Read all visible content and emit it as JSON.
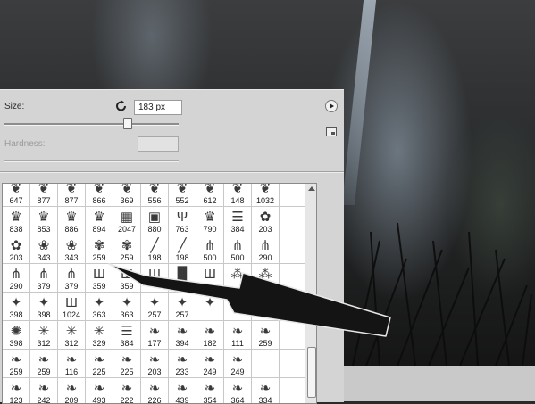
{
  "brush_panel": {
    "size_label": "Size:",
    "size_value": "183 px",
    "size_slider_fraction": 0.72,
    "hardness_label": "Hardness:",
    "hardness_value": "",
    "icons": {
      "reset": "reset-rotate-icon",
      "menu": "panel-menu-play-icon",
      "new_preset": "new-preset-icon"
    },
    "preset_rows": [
      [
        {
          "size": "647",
          "glyph": "❦"
        },
        {
          "size": "877",
          "glyph": "❦"
        },
        {
          "size": "877",
          "glyph": "❦"
        },
        {
          "size": "866",
          "glyph": "❦"
        },
        {
          "size": "369",
          "glyph": "❦"
        },
        {
          "size": "556",
          "glyph": "❦"
        },
        {
          "size": "552",
          "glyph": "❦"
        },
        {
          "size": "612",
          "glyph": "❦"
        },
        {
          "size": "148",
          "glyph": "❦"
        },
        {
          "size": "1032",
          "glyph": "❦"
        },
        {
          "size": "",
          "glyph": ""
        }
      ],
      [
        {
          "size": "838",
          "glyph": "♛"
        },
        {
          "size": "853",
          "glyph": "♛"
        },
        {
          "size": "886",
          "glyph": "♛"
        },
        {
          "size": "894",
          "glyph": "♛"
        },
        {
          "size": "2047",
          "glyph": "▦"
        },
        {
          "size": "880",
          "glyph": "▣"
        },
        {
          "size": "763",
          "glyph": "Ψ"
        },
        {
          "size": "790",
          "glyph": "♛"
        },
        {
          "size": "384",
          "glyph": "☰"
        },
        {
          "size": "203",
          "glyph": "✿"
        },
        {
          "size": "",
          "glyph": ""
        }
      ],
      [
        {
          "size": "203",
          "glyph": "✿"
        },
        {
          "size": "343",
          "glyph": "❀"
        },
        {
          "size": "343",
          "glyph": "❀"
        },
        {
          "size": "259",
          "glyph": "✾"
        },
        {
          "size": "259",
          "glyph": "✾"
        },
        {
          "size": "198",
          "glyph": "╱"
        },
        {
          "size": "198",
          "glyph": "╱"
        },
        {
          "size": "500",
          "glyph": "⋔"
        },
        {
          "size": "500",
          "glyph": "⋔"
        },
        {
          "size": "290",
          "glyph": "⋔"
        },
        {
          "size": "",
          "glyph": ""
        }
      ],
      [
        {
          "size": "290",
          "glyph": "⋔"
        },
        {
          "size": "379",
          "glyph": "⋔"
        },
        {
          "size": "379",
          "glyph": "⋔"
        },
        {
          "size": "359",
          "glyph": "Ш"
        },
        {
          "size": "359",
          "glyph": "Ш"
        },
        {
          "size": "",
          "glyph": "Ш"
        },
        {
          "size": "",
          "glyph": "█"
        },
        {
          "size": "",
          "glyph": "Ш"
        },
        {
          "size": "",
          "glyph": "⁂"
        },
        {
          "size": "500",
          "glyph": "⁂"
        },
        {
          "size": "",
          "glyph": ""
        }
      ],
      [
        {
          "size": "398",
          "glyph": "✦"
        },
        {
          "size": "398",
          "glyph": "✦"
        },
        {
          "size": "1024",
          "glyph": "Ш"
        },
        {
          "size": "363",
          "glyph": "✦"
        },
        {
          "size": "363",
          "glyph": "✦"
        },
        {
          "size": "257",
          "glyph": "✦"
        },
        {
          "size": "257",
          "glyph": "✦"
        },
        {
          "size": "",
          "glyph": "✦"
        },
        {
          "size": "",
          "glyph": "✦"
        },
        {
          "size": "",
          "glyph": ""
        },
        {
          "size": "",
          "glyph": ""
        }
      ],
      [
        {
          "size": "398",
          "glyph": "✺"
        },
        {
          "size": "312",
          "glyph": "✳"
        },
        {
          "size": "312",
          "glyph": "✳"
        },
        {
          "size": "329",
          "glyph": "✳"
        },
        {
          "size": "384",
          "glyph": "☰"
        },
        {
          "size": "177",
          "glyph": "❧"
        },
        {
          "size": "394",
          "glyph": "❧"
        },
        {
          "size": "182",
          "glyph": "❧"
        },
        {
          "size": "111",
          "glyph": "❧"
        },
        {
          "size": "259",
          "glyph": "❧"
        },
        {
          "size": "",
          "glyph": ""
        }
      ],
      [
        {
          "size": "259",
          "glyph": "❧"
        },
        {
          "size": "259",
          "glyph": "❧"
        },
        {
          "size": "116",
          "glyph": "❧"
        },
        {
          "size": "225",
          "glyph": "❧"
        },
        {
          "size": "225",
          "glyph": "❧"
        },
        {
          "size": "203",
          "glyph": "❧"
        },
        {
          "size": "233",
          "glyph": "❧"
        },
        {
          "size": "249",
          "glyph": "❧"
        },
        {
          "size": "249",
          "glyph": "❧"
        },
        {
          "size": "",
          "glyph": ""
        },
        {
          "size": "",
          "glyph": ""
        }
      ],
      [
        {
          "size": "123",
          "glyph": "❧"
        },
        {
          "size": "242",
          "glyph": "❧"
        },
        {
          "size": "209",
          "glyph": "❧"
        },
        {
          "size": "493",
          "glyph": "❧"
        },
        {
          "size": "222",
          "glyph": "❧"
        },
        {
          "size": "226",
          "glyph": "❧"
        },
        {
          "size": "439",
          "glyph": "❧"
        },
        {
          "size": "354",
          "glyph": "❧"
        },
        {
          "size": "364",
          "glyph": "❧"
        },
        {
          "size": "334",
          "glyph": "❧"
        },
        {
          "size": "",
          "glyph": ""
        }
      ]
    ]
  }
}
